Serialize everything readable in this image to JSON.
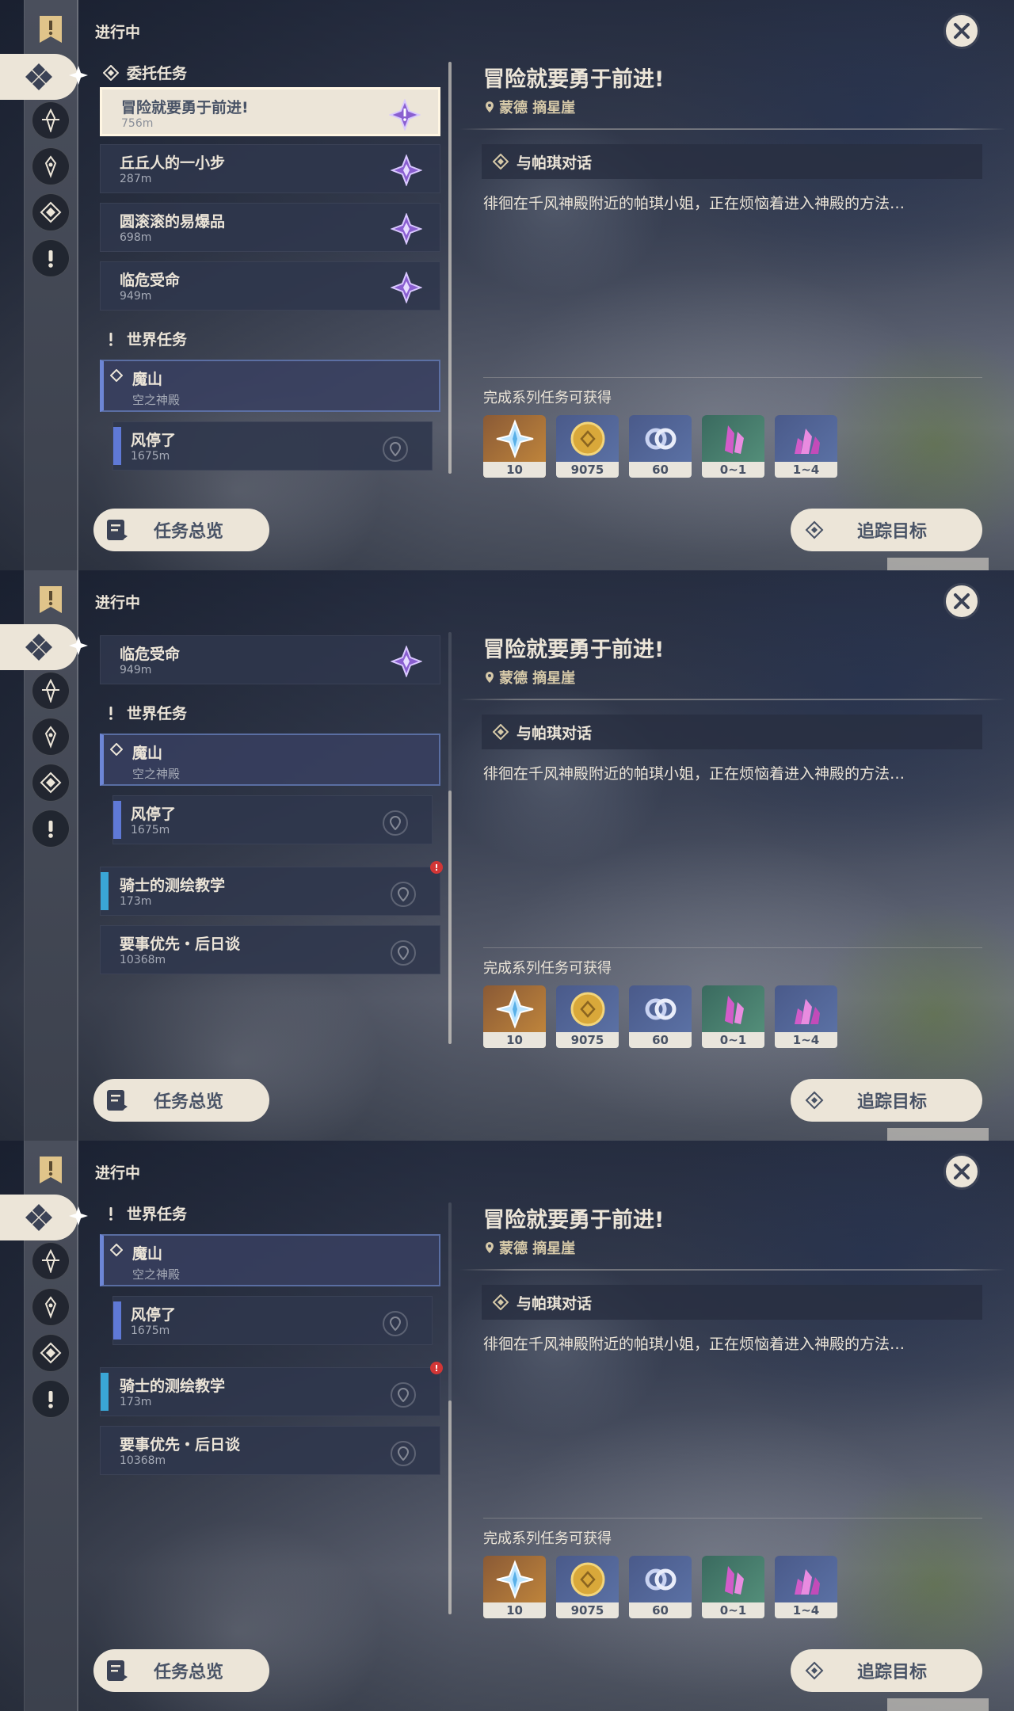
{
  "header": {
    "status_label": "进行中"
  },
  "sections": {
    "commission": "委托任务",
    "world": "世界任务"
  },
  "quests": {
    "q1": {
      "title": "冒险就要勇于前进!",
      "dist": "756m"
    },
    "q2": {
      "title": "丘丘人的一小步",
      "dist": "287m"
    },
    "q3": {
      "title": "圆滚滚的易爆品",
      "dist": "698m"
    },
    "q4": {
      "title": "临危受命",
      "dist": "949m"
    },
    "chapter": {
      "title": "魔山",
      "subtitle": "空之神殿"
    },
    "sub1": {
      "title": "风停了",
      "dist": "1675m"
    },
    "w1": {
      "title": "骑士的测绘教学",
      "dist": "173m",
      "badge": "!"
    },
    "w2": {
      "title": "要事优先・后日谈",
      "dist": "10368m"
    }
  },
  "detail": {
    "title": "冒险就要勇于前进!",
    "location": "蒙德 摘星崖",
    "step": "与帕琪对话",
    "description": "徘徊在千风神殿附近的帕琪小姐，正在烦恼着进入神殿的方法…",
    "reward_label": "完成系列任务可获得",
    "rewards": [
      {
        "icon": "primogem-icon",
        "count": "10"
      },
      {
        "icon": "mora-icon",
        "count": "9075"
      },
      {
        "icon": "adventure-exp-icon",
        "count": "60"
      },
      {
        "icon": "crystal-icon",
        "count": "0~1"
      },
      {
        "icon": "crystal-cluster-icon",
        "count": "1~4"
      }
    ]
  },
  "buttons": {
    "overview": "任务总览",
    "track": "追踪目标"
  },
  "colors": {
    "cream": "#ece5d8",
    "card": "#2f374c",
    "chapter_accent": "#6d86d6",
    "world_accent": "#3aa6d6",
    "badge_red": "#d23636"
  }
}
